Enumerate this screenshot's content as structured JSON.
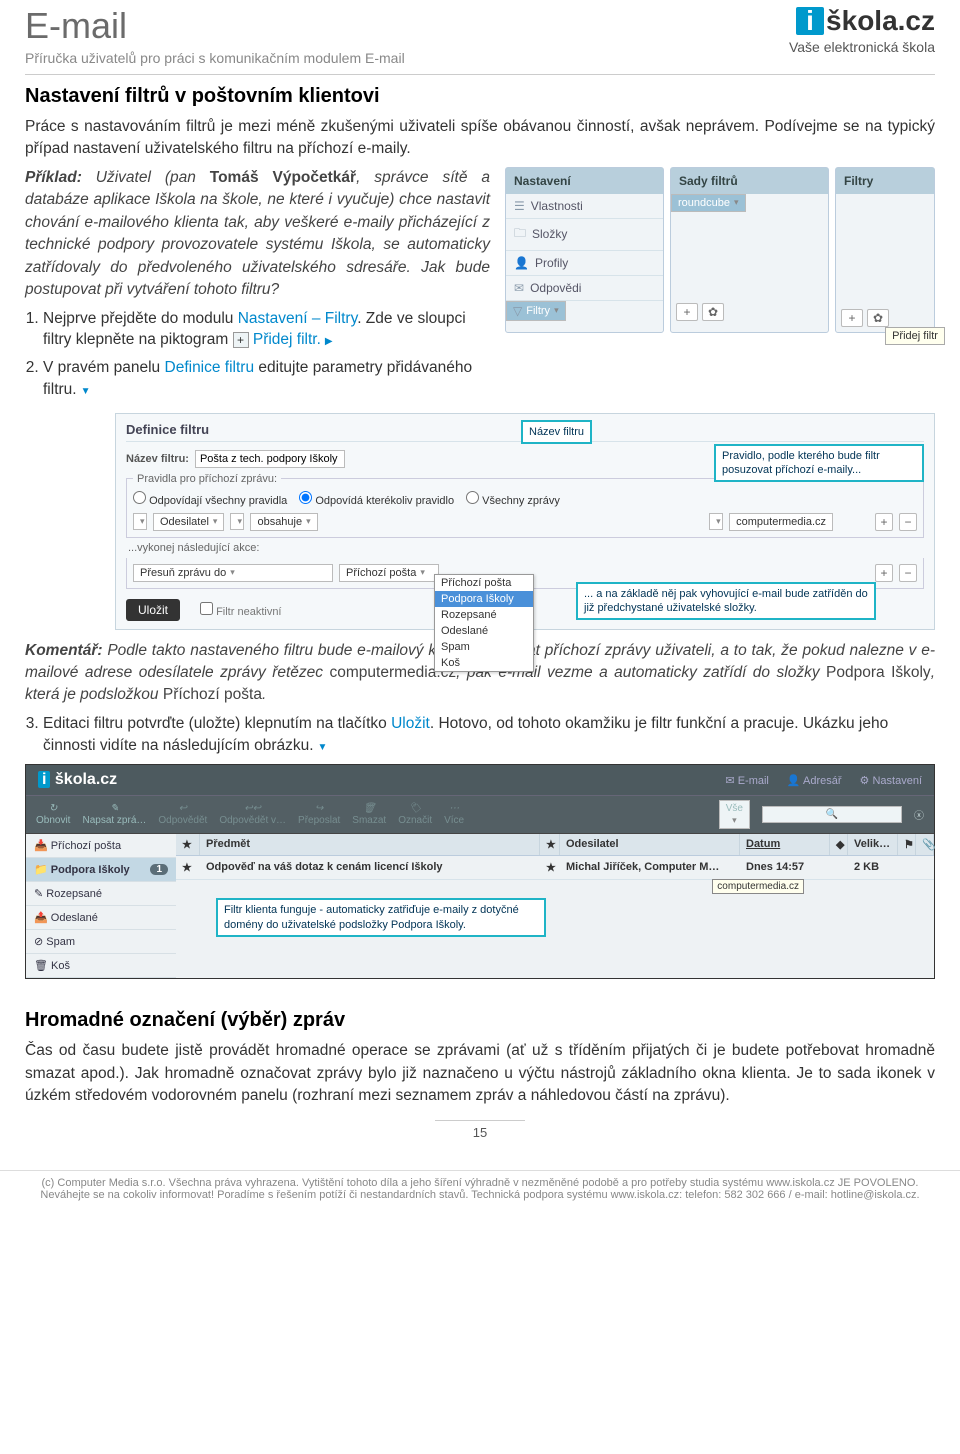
{
  "header": {
    "title": "E-mail",
    "subtitle": "Příručka uživatelů pro práci s komunikačním modulem E-mail",
    "logo_i": "i",
    "logo_rest": "škola.cz",
    "tagline": "Vaše elektronická škola"
  },
  "s1": {
    "h": "Nastavení filtrů v poštovním klientovi",
    "p1": "Práce s nastavováním filtrů je mezi méně zkušenými uživateli spíše obávanou činností, avšak neprávem. Podívejme se na typický případ nastavení uživatelského filtru na příchozí e-maily.",
    "ex_lead": "Příklad: ",
    "ex_body_a": "Uživatel (pan ",
    "ex_bold": "Tomáš Výpočetkář",
    "ex_body_b": ", správce sítě a databáze aplikace Iškola na škole, ne které i vyučuje) chce nastavit chování e-mailového klienta tak, aby veškeré e-maily přicházející z technické podpory provozovatele systému Iškola, se automaticky zatřídovaly do předvoleného uživatelského sdresáře. Jak bude postupovat při vytváření tohoto filtru?",
    "li1a": "Nejprve přejděte do modulu ",
    "li1_link": "Nastavení – Filtry",
    "li1b": ". Zde ve sloupci filtry klepněte na piktogram ",
    "li1c": " ",
    "li1_link2": "Přidej filtr.",
    "li2a": "V pravém panelu ",
    "li2_link": "Definice filtru",
    "li2b": " editujte parametry přidávaného filtru.",
    "comment_lead": "Komentář: ",
    "comment_a": "Podle takto nastaveného filtru bude e-mailový klient posuzovat příchozí zprávy uživateli, a to tak, že pokud nalezne v e-mailové adrese odesílatele zprávy řetězec ",
    "comment_b": "computermedia.cz",
    "comment_c": ", pak e-mail vezme a automaticky zatřídí do složky ",
    "comment_d": "Podpora Iškoly",
    "comment_e": ", která je podsložkou ",
    "comment_f": "Příchozí pošta",
    "comment_g": ".",
    "li3a": "Editaci filtru potvrďte (uložte) klepnutím na tlačítko ",
    "li3_link": "Uložit",
    "li3b": ". Hotovo, od tohoto okamžiku je filtr funkční a pracuje. Ukázku jeho činnosti vidíte na následujícím obrázku."
  },
  "panel": {
    "c1h": "Nastavení",
    "c1i": [
      "Vlastnosti",
      "Složky",
      "Profily",
      "Odpovědi",
      "Filtry"
    ],
    "c2h": "Sady filtrů",
    "c2i": [
      "roundcube"
    ],
    "c3h": "Filtry",
    "tooltip": "Přidej filtr",
    "plus": "+",
    "gear": "✿"
  },
  "def": {
    "title": "Definice filtru",
    "name_label": "Název filtru:",
    "name_value": "Pošta z tech. podpory Iškoly",
    "rules_legend": "Pravidla pro příchozí zprávu:",
    "r1": "Odpovídají všechny pravidla",
    "r2": "Odpovídá kterékoliv pravidlo",
    "r3": "Všechny zprávy",
    "rule_field": "Odesilatel",
    "rule_op": "obsahuje",
    "rule_val": "computermedia.cz",
    "actions_legend": "...vykonej následující akce:",
    "act_do": "Přesuň zprávu do",
    "act_target": "Příchozí pošta",
    "dd": [
      "Příchozí pošta",
      "Podpora Iškoly",
      "Rozepsané",
      "Odeslané",
      "Spam",
      "Koš"
    ],
    "save": "Uložit",
    "inactive": "Filtr neaktivní",
    "call1": "Název filtru",
    "call2": "Pravidlo, podle kterého bude filtr posuzovat příchozí e-maily...",
    "call3": "... a na základě něj pak vyhovující e-mail bude zatříděn do již předchystané uživatelské složky."
  },
  "mail": {
    "logo": "škola.cz",
    "nav": [
      "E-mail",
      "Adresář",
      "Nastavení"
    ],
    "tools": [
      "Obnovit",
      "Napsat zprá…",
      "Odpovědět",
      "Odpovědět v…",
      "Přeposlat",
      "Smazat",
      "Označit",
      "Více"
    ],
    "filter": "Vše",
    "folders": [
      {
        "n": "Příchozí pošta"
      },
      {
        "n": "Podpora Iškoly",
        "sel": true,
        "badge": "1"
      },
      {
        "n": "Rozepsané"
      },
      {
        "n": "Odeslané"
      },
      {
        "n": "Spam"
      },
      {
        "n": "Koš"
      }
    ],
    "cols": {
      "star": "★",
      "subj": "Předmět",
      "star2": "★",
      "from": "Odesilatel",
      "date": "Datum",
      "sort": "◆",
      "size": "Velik…",
      "flag": "⚑",
      "att": "📎"
    },
    "row": {
      "star": "★",
      "subj": "Odpověď na váš dotaz k cenám licencí Iškoly",
      "star2": "★",
      "from": "Michal Jiříček, Computer M…",
      "date": "Dnes 14:57",
      "size": "2 KB"
    },
    "callout": "Filtr klienta funguje - automaticky zatřiďuje e-maily z dotyčné domény do uživatelské podsložky Podpora Iškoly.",
    "tooltip": "computermedia.cz"
  },
  "s2": {
    "h": "Hromadné označení (výběr) zpráv",
    "p": "Čas od času budete jistě provádět hromadné operace se zprávami (ať už s tříděním přijatých či je budete potřebovat  hromadně smazat apod.). Jak hromadně označovat zprávy bylo již naznačeno u výčtu nástrojů základního okna klienta. Je to sada ikonek v úzkém středovém vodorovném panelu (rozhraní mezi seznamem zpráv a náhledovou částí na zprávu)."
  },
  "page": "15",
  "footer": {
    "l1": "(c) Computer Media s.r.o. Všechna práva vyhrazena. Vytištění tohoto díla a jeho šíření výhradně v nezměněné podobě a pro potřeby studia systému www.iskola.cz JE POVOLENO.",
    "l2": "Neváhejte se na cokoliv informovat! Poradíme s řešením potíží či nestandardních stavů. Technická podpora systému www.iskola.cz: telefon: 582 302 666 / e-mail: hotline@iskola.cz."
  }
}
